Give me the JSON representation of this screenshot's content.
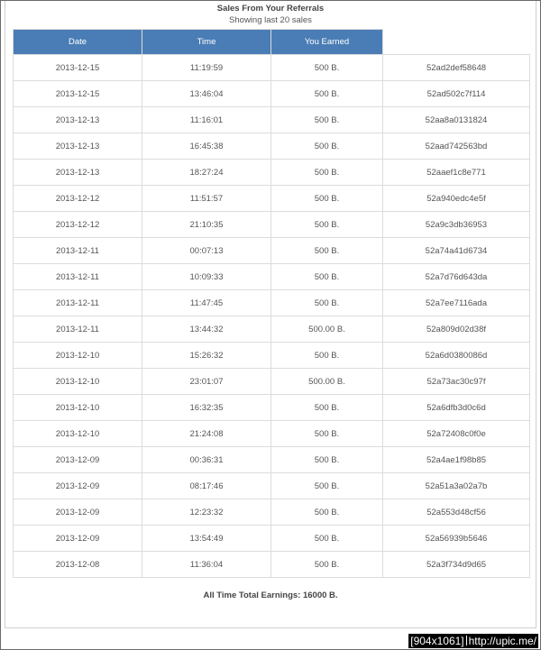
{
  "title": "Sales From Your Referrals",
  "subtitle": "Showing last 20 sales",
  "table": {
    "headers": [
      "Date",
      "Time",
      "You Earned"
    ],
    "rows": [
      [
        "2013-12-15",
        "11:19:59",
        "500 B.",
        "52ad2def58648"
      ],
      [
        "2013-12-15",
        "13:46:04",
        "500 B.",
        "52ad502c7f114"
      ],
      [
        "2013-12-13",
        "11:16:01",
        "500 B.",
        "52aa8a0131824"
      ],
      [
        "2013-12-13",
        "16:45:38",
        "500 B.",
        "52aad742563bd"
      ],
      [
        "2013-12-13",
        "18:27:24",
        "500 B.",
        "52aaef1c8e771"
      ],
      [
        "2013-12-12",
        "11:51:57",
        "500 B.",
        "52a940edc4e5f"
      ],
      [
        "2013-12-12",
        "21:10:35",
        "500 B.",
        "52a9c3db36953"
      ],
      [
        "2013-12-11",
        "00:07:13",
        "500 B.",
        "52a74a41d6734"
      ],
      [
        "2013-12-11",
        "10:09:33",
        "500 B.",
        "52a7d76d643da"
      ],
      [
        "2013-12-11",
        "11:47:45",
        "500 B.",
        "52a7ee7116ada"
      ],
      [
        "2013-12-11",
        "13:44:32",
        "500.00 B.",
        "52a809d02d38f"
      ],
      [
        "2013-12-10",
        "15:26:32",
        "500 B.",
        "52a6d0380086d"
      ],
      [
        "2013-12-10",
        "23:01:07",
        "500.00 B.",
        "52a73ac30c97f"
      ],
      [
        "2013-12-10",
        "16:32:35",
        "500 B.",
        "52a6dfb3d0c6d"
      ],
      [
        "2013-12-10",
        "21:24:08",
        "500 B.",
        "52a72408c0f0e"
      ],
      [
        "2013-12-09",
        "00:36:31",
        "500 B.",
        "52a4ae1f98b85"
      ],
      [
        "2013-12-09",
        "08:17:46",
        "500 B.",
        "52a51a3a02a7b"
      ],
      [
        "2013-12-09",
        "12:23:32",
        "500 B.",
        "52a553d48cf56"
      ],
      [
        "2013-12-09",
        "13:54:49",
        "500 B.",
        "52a56939b5646"
      ],
      [
        "2013-12-08",
        "11:36:04",
        "500 B.",
        "52a3f734d9d65"
      ]
    ]
  },
  "footer": {
    "total_label": "All Time Total Earnings: 16000 B."
  },
  "watermark": {
    "size": "[904x1061]",
    "url": "http://upic.me/"
  },
  "colors": {
    "header_bg": "#4a7db5",
    "header_text": "#ffffff",
    "cell_text": "#555555",
    "border": "#dcdcdc"
  }
}
